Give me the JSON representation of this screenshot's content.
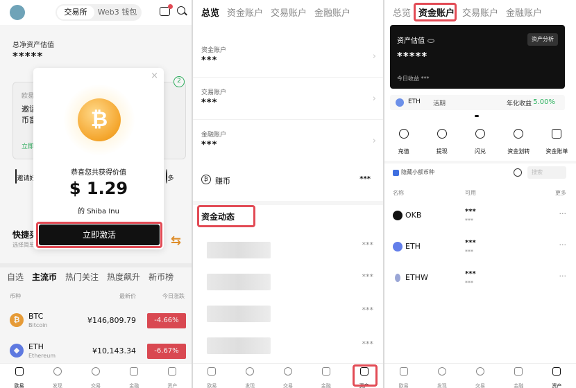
{
  "screen1": {
    "segment": {
      "exchange": "交易所",
      "web3": "Web3 钱包"
    },
    "total_assets_label": "总净资产估值",
    "total_assets_value": "*****",
    "card": {
      "line1": "欧易",
      "line2": "邀请",
      "line3": "币富",
      "link": "立即"
    },
    "card_badge": "2",
    "quick_items": [
      {
        "label": "邀请好"
      },
      {
        "label": "多"
      }
    ],
    "quick_title": "快捷买",
    "quick_sub": "选择简单",
    "market_tabs": [
      "自选",
      "主流币",
      "热门关注",
      "热度飙升",
      "新币榜"
    ],
    "market_header": {
      "coin": "币种",
      "price": "最新价",
      "change": "今日涨跌"
    },
    "coins": [
      {
        "symbol": "BTC",
        "name": "Bitcoin",
        "price": "¥146,809.79",
        "change": "-4.66%",
        "icon_color": "#f0a23a"
      },
      {
        "symbol": "ETH",
        "name": "Ethereum",
        "price": "¥10,143.34",
        "change": "-6.67%",
        "icon_color": "#627eea"
      }
    ],
    "popup": {
      "close": "×",
      "congrats": "恭喜您共获得价值",
      "amount": "$ 1.29",
      "of_text": "的 Shiba Inu",
      "activate": "立即激活"
    },
    "bottom_nav": [
      "欧易",
      "发现",
      "交易",
      "金融",
      "资产"
    ]
  },
  "screen2": {
    "tabs": [
      "总览",
      "资金账户",
      "交易账户",
      "金融账户"
    ],
    "accounts": [
      {
        "label": "资金账户",
        "value": "***"
      },
      {
        "label": "交易账户",
        "value": "***"
      },
      {
        "label": "金融账户",
        "value": "***"
      }
    ],
    "earn": {
      "label": "赚币",
      "value": "***"
    },
    "fund_activity": "资金动态",
    "activity_dots": [
      "***",
      "***",
      "***",
      "***"
    ],
    "bottom_nav": [
      "欧易",
      "发现",
      "交易",
      "金融",
      "资产"
    ]
  },
  "screen3": {
    "tabs": [
      "总览",
      "资金账户",
      "交易账户",
      "金融账户"
    ],
    "valuation_label": "资产估值",
    "valuation_value": "*****",
    "analysis_btn": "资产分析",
    "today_label": "今日收益 ***",
    "eth_bar": {
      "coin": "ETH",
      "type": "活期",
      "yield_label": "年化收益",
      "yield": "5.00%"
    },
    "actions": [
      "充值",
      "提现",
      "闪兑",
      "资金划转",
      "资金账单"
    ],
    "hide_small": "隐藏小额币种",
    "search_placeholder": "搜索",
    "list_header": {
      "name": "名称",
      "available": "可用",
      "more": "更多"
    },
    "coins": [
      {
        "symbol": "OKB",
        "v1": "***",
        "v2": "***",
        "icon_color": "#111111"
      },
      {
        "symbol": "ETH",
        "v1": "***",
        "v2": "***",
        "icon_color": "#627eea"
      },
      {
        "symbol": "ETHW",
        "v1": "***",
        "v2": "***",
        "icon_color": "#9aa6d6"
      }
    ],
    "more_dots": "···",
    "bottom_nav": [
      "欧易",
      "发现",
      "交易",
      "金融",
      "资产"
    ]
  },
  "colors": {
    "highlight": "#e24b55",
    "down": "#e24b55",
    "up": "#2db35f"
  }
}
